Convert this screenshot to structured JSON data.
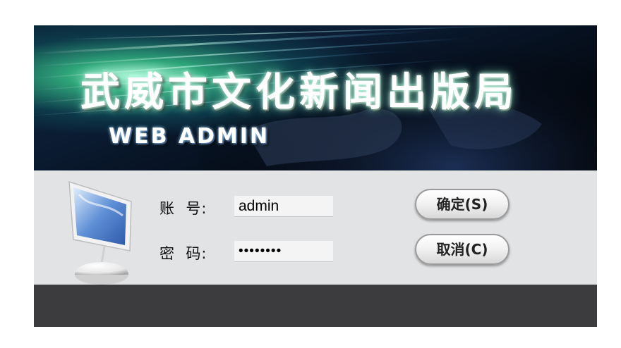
{
  "banner": {
    "title": "武威市文化新闻出版局",
    "subtitle": "WEB ADMIN"
  },
  "login": {
    "account_label": "账  号:",
    "account_value": "admin",
    "password_label": "密  码:",
    "password_value": "••••••••"
  },
  "buttons": {
    "confirm": "确定(S)",
    "cancel": "取消(C)"
  },
  "colors": {
    "form_bg": "#e2e3e5",
    "footer_bg": "#3c3c3e"
  },
  "icons": {
    "computer": "imac-computer-icon"
  }
}
